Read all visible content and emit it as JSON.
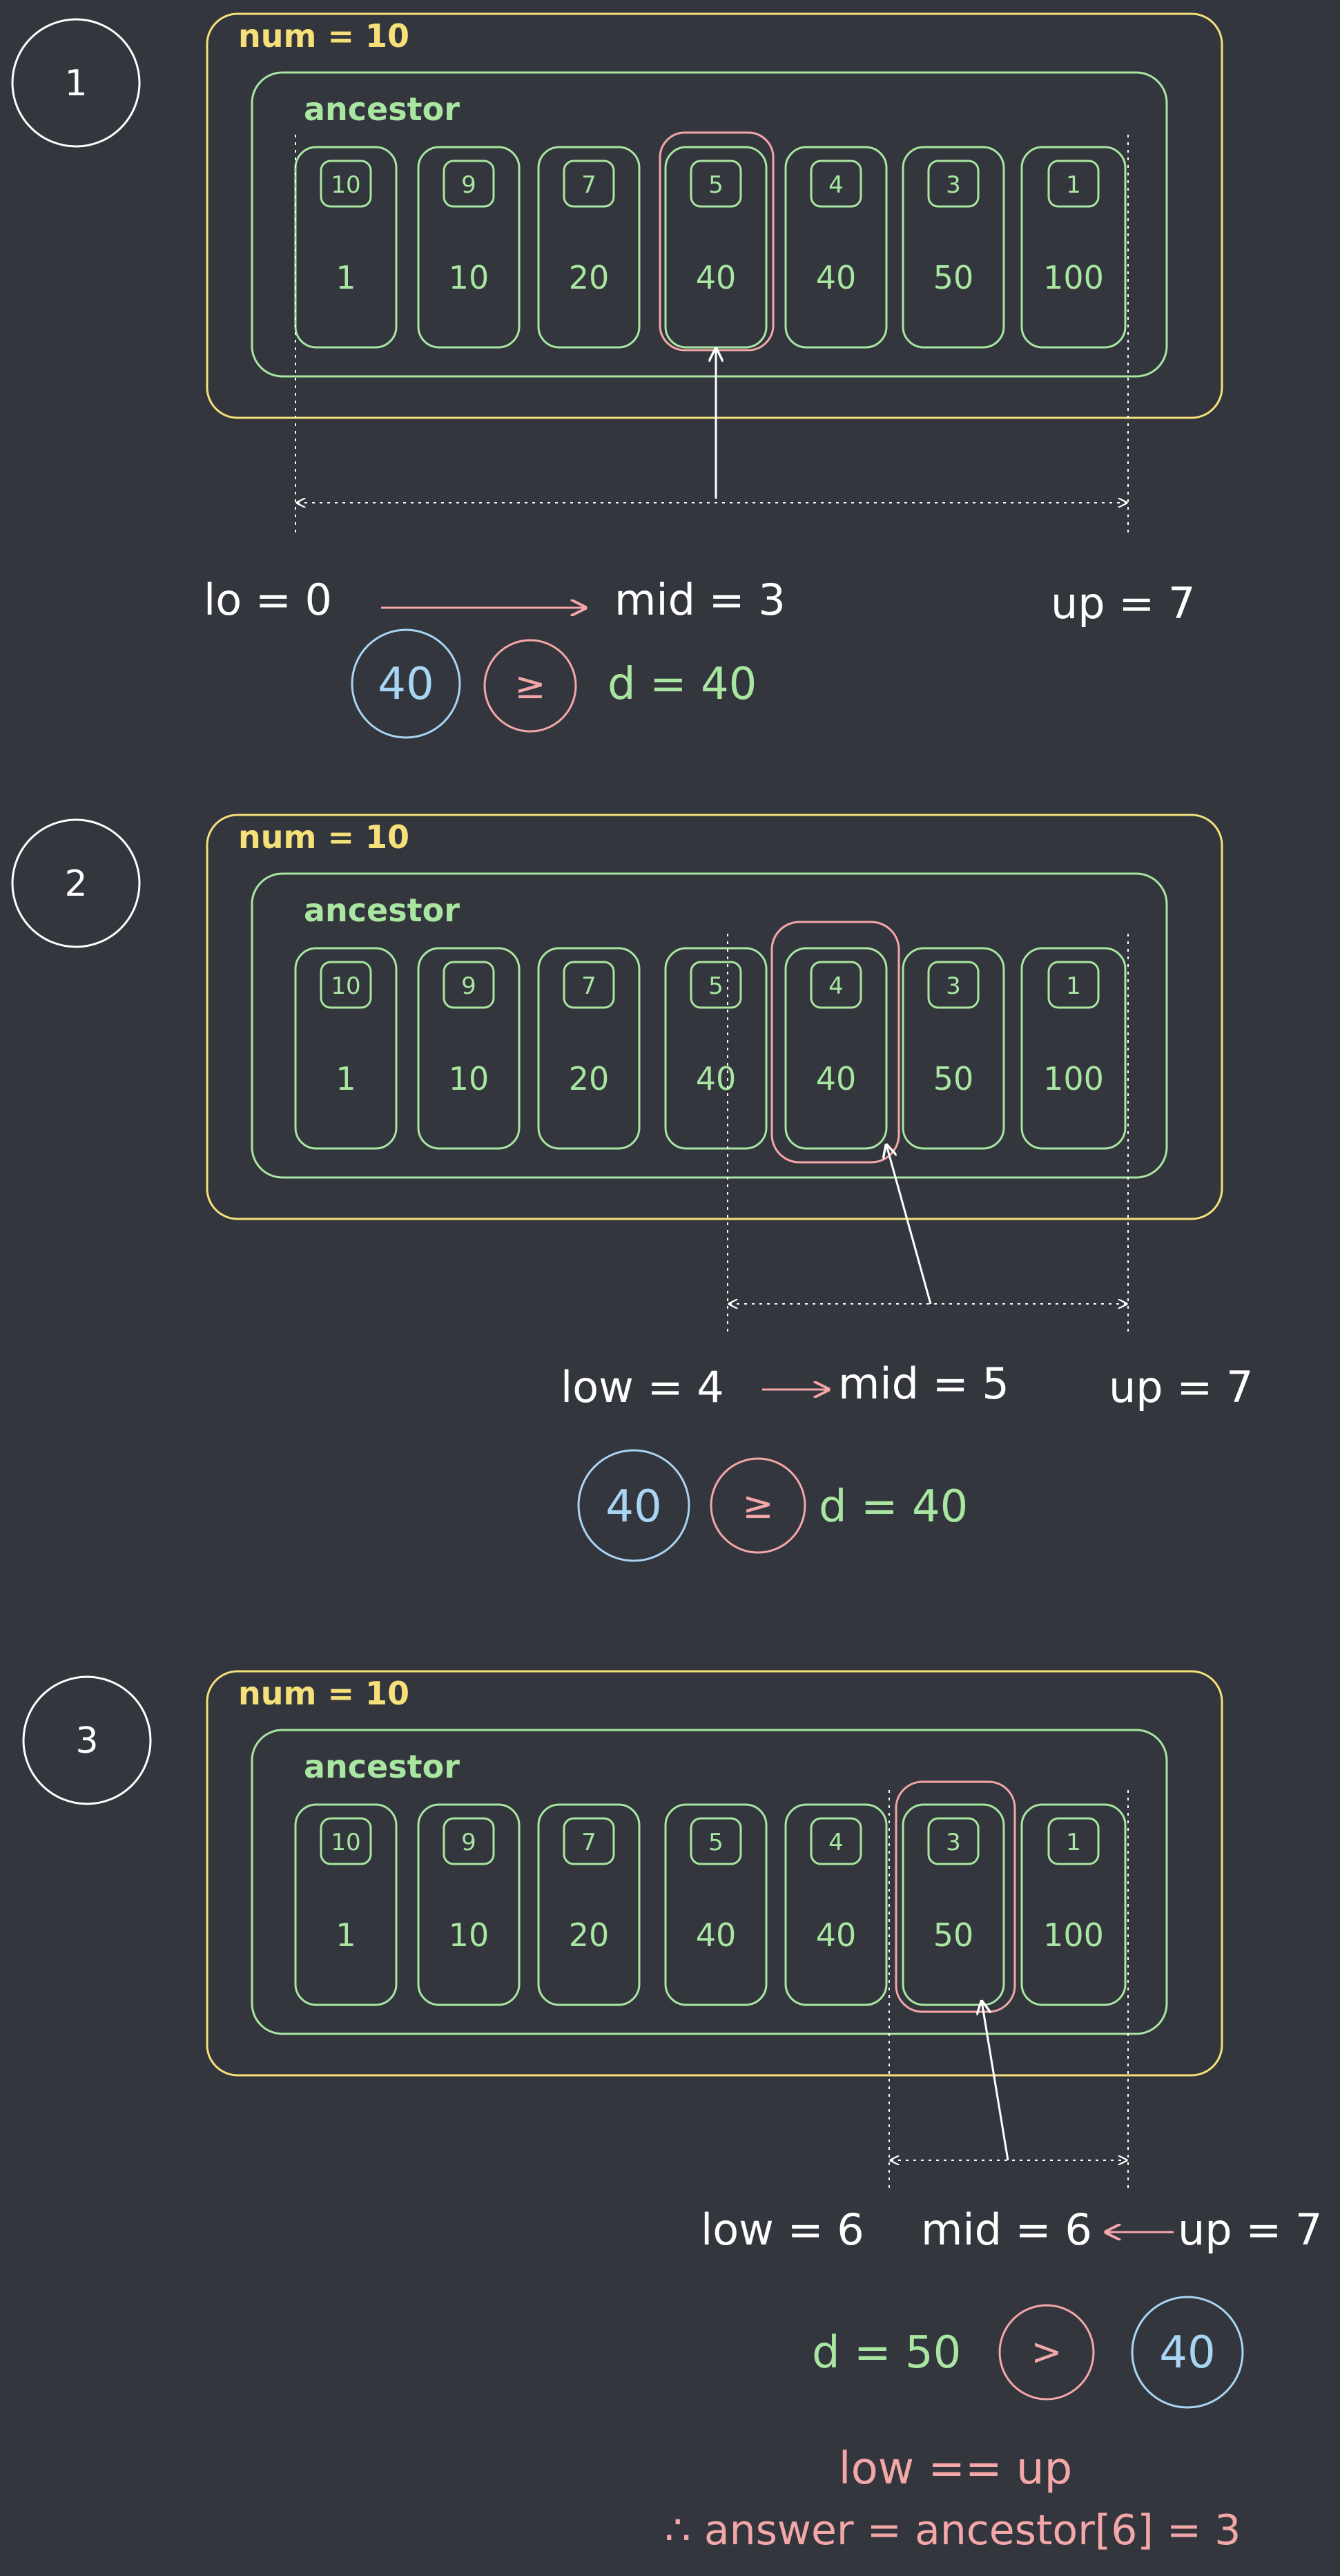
{
  "colors": {
    "background": "#33363c",
    "yellow": "#f5e07a",
    "green": "#a8e6a1",
    "pink": "#f4a7a9",
    "blue": "#a9d5f5",
    "white": "#ffffff"
  },
  "panels": [
    {
      "step": "1",
      "num_label": "num = 10",
      "ancestor_label": "ancestor",
      "cells": [
        {
          "index": "10",
          "value": "1"
        },
        {
          "index": "9",
          "value": "10"
        },
        {
          "index": "7",
          "value": "20"
        },
        {
          "index": "5",
          "value": "40"
        },
        {
          "index": "4",
          "value": "40"
        },
        {
          "index": "3",
          "value": "50"
        },
        {
          "index": "1",
          "value": "100"
        }
      ],
      "highlight_cell": 3,
      "range": [
        0,
        7
      ],
      "lo_text": "lo = 0",
      "mid_text": "mid = 3",
      "up_text": "up = 7",
      "compare": {
        "left": "40",
        "op": "≥",
        "right": "d = 40"
      }
    },
    {
      "step": "2",
      "num_label": "num = 10",
      "ancestor_label": "ancestor",
      "cells": [
        {
          "index": "10",
          "value": "1"
        },
        {
          "index": "9",
          "value": "10"
        },
        {
          "index": "7",
          "value": "20"
        },
        {
          "index": "5",
          "value": "40"
        },
        {
          "index": "4",
          "value": "40"
        },
        {
          "index": "3",
          "value": "50"
        },
        {
          "index": "1",
          "value": "100"
        }
      ],
      "highlight_cell": 4,
      "range": [
        4,
        7
      ],
      "lo_text": "low = 4",
      "mid_text": "mid = 5",
      "up_text": "up = 7",
      "compare": {
        "left": "40",
        "op": "≥",
        "right": "d = 40"
      }
    },
    {
      "step": "3",
      "num_label": "num = 10",
      "ancestor_label": "ancestor",
      "cells": [
        {
          "index": "10",
          "value": "1"
        },
        {
          "index": "9",
          "value": "10"
        },
        {
          "index": "7",
          "value": "20"
        },
        {
          "index": "5",
          "value": "40"
        },
        {
          "index": "4",
          "value": "40"
        },
        {
          "index": "3",
          "value": "50"
        },
        {
          "index": "1",
          "value": "100"
        }
      ],
      "highlight_cell": 5,
      "range": [
        5,
        7
      ],
      "lo_text": "low = 6",
      "mid_text": "mid = 6",
      "up_text": "up = 7",
      "compare": {
        "left": "d = 50",
        "op": ">",
        "right": "40"
      }
    }
  ],
  "conclusion": {
    "line1": "low == up",
    "line2": "∴ answer = ancestor[6] = 3"
  }
}
